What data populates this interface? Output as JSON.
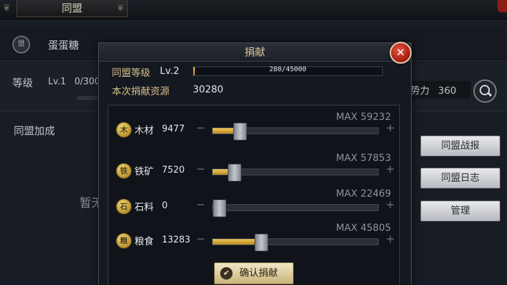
{
  "background": {
    "tab_title": "同盟",
    "alliance_name": "蛋蛋糖",
    "level_label": "等级",
    "level_value": "Lv.1",
    "level_exp_fragment": "0/300",
    "power_label": "势力",
    "power_value": "360",
    "bonus_label": "同盟加成",
    "temporary_fragment": "暂无",
    "side_buttons": [
      "同盟战报",
      "同盟日志",
      "管理"
    ]
  },
  "dialog": {
    "title": "捐献",
    "alliance_level_label": "同盟等级",
    "alliance_level_value": "Lv.2",
    "exp_text": "280/45000",
    "exp_progress": 0.0062,
    "donation_label": "本次捐献资源",
    "donation_total": "30280",
    "resources": [
      {
        "name": "木材",
        "icon": "wood-icon",
        "glyph": "木",
        "count": "9477",
        "max": "MAX 59232",
        "fraction": 0.16
      },
      {
        "name": "铁矿",
        "icon": "iron-ore-icon",
        "glyph": "铁",
        "count": "7520",
        "max": "MAX 57853",
        "fraction": 0.13
      },
      {
        "name": "石料",
        "icon": "stone-icon",
        "glyph": "石",
        "count": "0",
        "max": "MAX 22469",
        "fraction": 0.0
      },
      {
        "name": "粮食",
        "icon": "grain-icon",
        "glyph": "粮",
        "count": "13283",
        "max": "MAX 45805",
        "fraction": 0.29
      }
    ],
    "confirm_label": "确认捐献",
    "close_glyph": "✕",
    "minus_glyph": "−",
    "plus_glyph": "+"
  },
  "colors": {
    "accent_gold": "#d9c18a",
    "slider_fill": "#f0c856",
    "close_red": "#c2321f"
  }
}
